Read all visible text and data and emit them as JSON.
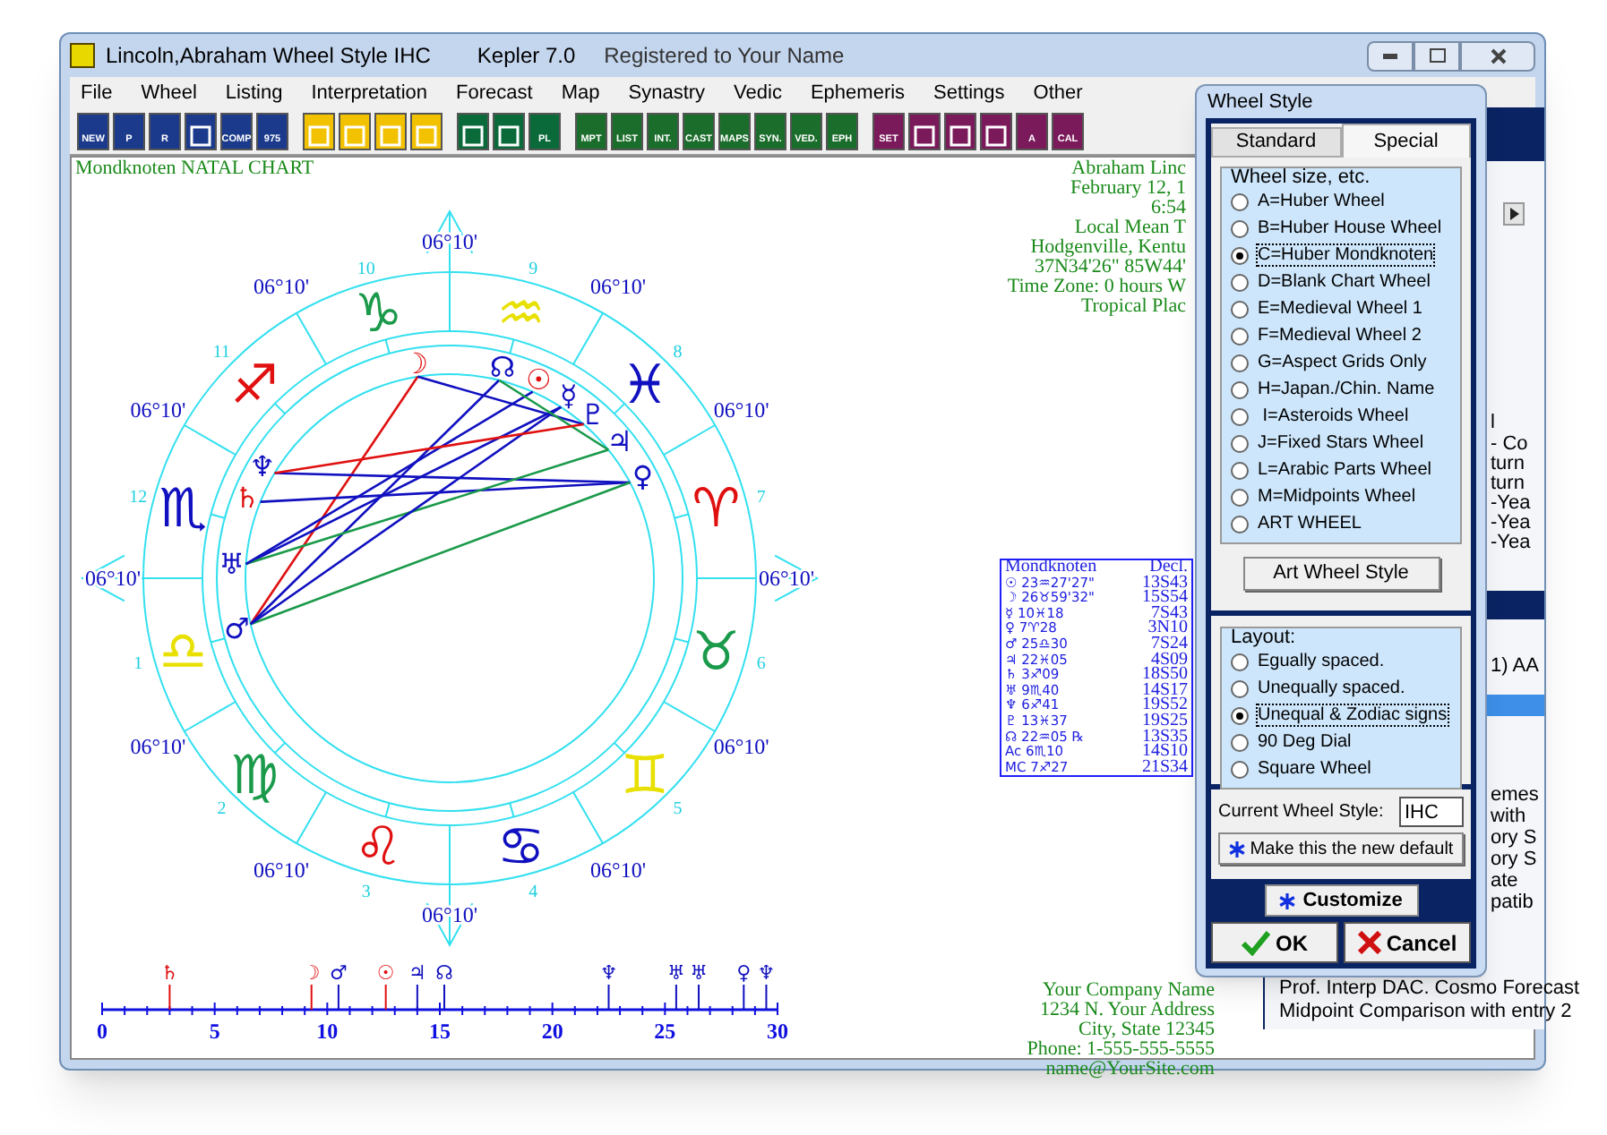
{
  "window": {
    "title": "Lincoln,Abraham Wheel Style IHC",
    "app": "Kepler 7.0",
    "registration": "Registered to Your Name"
  },
  "menu": [
    {
      "label": "File"
    },
    {
      "label": "Wheel"
    },
    {
      "label": "Listing"
    },
    {
      "label": "Interpretation"
    },
    {
      "label": "Forecast"
    },
    {
      "label": "Map"
    },
    {
      "label": "Synastry"
    },
    {
      "label": "Vedic"
    },
    {
      "label": "Ephemeris"
    },
    {
      "label": "Settings"
    },
    {
      "label": "Other"
    }
  ],
  "toolbar_groups": [
    [
      {
        "kind": "text",
        "label": "NEW"
      },
      {
        "kind": "text",
        "label": "P"
      },
      {
        "kind": "text",
        "label": "R"
      },
      {
        "kind": "icon"
      },
      {
        "kind": "text",
        "label": "COMP"
      },
      {
        "kind": "text",
        "label": "975"
      }
    ],
    [
      {
        "kind": "icon"
      },
      {
        "kind": "icon"
      },
      {
        "kind": "icon"
      },
      {
        "kind": "icon"
      }
    ],
    [
      {
        "kind": "icon"
      },
      {
        "kind": "icon"
      },
      {
        "kind": "text",
        "label": "PL"
      }
    ],
    [
      {
        "kind": "text",
        "label": "MPT"
      },
      {
        "kind": "text",
        "label": "LIST"
      },
      {
        "kind": "text",
        "label": "INT."
      },
      {
        "kind": "text",
        "label": "CAST"
      },
      {
        "kind": "text",
        "label": "MAPS"
      },
      {
        "kind": "text",
        "label": "SYN."
      },
      {
        "kind": "text",
        "label": "VED."
      },
      {
        "kind": "text",
        "label": "EPH"
      }
    ],
    [
      {
        "kind": "text",
        "label": "SET"
      },
      {
        "kind": "icon"
      },
      {
        "kind": "icon"
      },
      {
        "kind": "icon"
      },
      {
        "kind": "text",
        "label": "A"
      },
      {
        "kind": "text",
        "label": "CAL"
      }
    ]
  ],
  "chart": {
    "title": "Mondknoten NATAL CHART",
    "cusp_labels": [
      "06°10'",
      "06°10'",
      "06°10'",
      "06°10'",
      "06°10'",
      "06°10'",
      "06°10'",
      "06°10'",
      "06°10'",
      "06°10'",
      "06°10'",
      "06°10'"
    ],
    "houses": [
      "1",
      "2",
      "3",
      "4",
      "5",
      "6",
      "7",
      "8",
      "9",
      "10",
      "11",
      "12"
    ],
    "signs": [
      {
        "glyph": "♑",
        "color": "#1a9a4a"
      },
      {
        "glyph": "♒",
        "color": "#e8e000"
      },
      {
        "glyph": "♓",
        "color": "#1010c0"
      },
      {
        "glyph": "♈",
        "color": "#e01010"
      },
      {
        "glyph": "♉",
        "color": "#1a9a4a"
      },
      {
        "glyph": "♊",
        "color": "#e8e000"
      },
      {
        "glyph": "♋",
        "color": "#1010c0"
      },
      {
        "glyph": "♌",
        "color": "#e01010"
      },
      {
        "glyph": "♍",
        "color": "#1a9a4a"
      },
      {
        "glyph": "♎",
        "color": "#e8e000"
      },
      {
        "glyph": "♏",
        "color": "#1010c0"
      },
      {
        "glyph": "♐",
        "color": "#e01010"
      }
    ],
    "planets": [
      {
        "glyph": "☽",
        "color": "#e01010"
      },
      {
        "glyph": "☊",
        "color": "#1010c0"
      },
      {
        "glyph": "☉",
        "color": "#e01010"
      },
      {
        "glyph": "☿",
        "color": "#1010c0"
      },
      {
        "glyph": "♇",
        "color": "#1010c0"
      },
      {
        "glyph": "♃",
        "color": "#1010c0"
      },
      {
        "glyph": "♀",
        "color": "#1010c0"
      },
      {
        "glyph": "♆",
        "color": "#1010c0"
      },
      {
        "glyph": "♄",
        "color": "#e01010"
      },
      {
        "glyph": "♅",
        "color": "#1010c0"
      },
      {
        "glyph": "♂",
        "color": "#1010c0"
      }
    ]
  },
  "info_lines": [
    "Abraham Linc",
    "February 12, 1",
    "6:54",
    "Local Mean T",
    "Hodgenville, Kentu",
    "37N34'26\"  85W44'",
    "Time Zone: 0 hours W",
    "Tropical Plac"
  ],
  "positions_table": {
    "columns": [
      "Mondknoten",
      "Decl."
    ],
    "rows": [
      [
        "☉ 23♒27'27\"",
        "13S43"
      ],
      [
        "☽ 26♉59'32\"",
        "15S54"
      ],
      [
        "☿ 10♓18",
        "7S43"
      ],
      [
        "♀ 7♈28",
        "3N10"
      ],
      [
        "♂ 25♎30",
        "7S24"
      ],
      [
        "♃ 22♓05",
        "4S09"
      ],
      [
        "♄ 3♐09",
        "18S50"
      ],
      [
        "♅ 9♏40",
        "14S17"
      ],
      [
        "♆ 6♐41",
        "19S52"
      ],
      [
        "♇ 13♓37",
        "19S25"
      ],
      [
        "☊ 22♒05 ℞",
        "13S35"
      ],
      [
        "Ac 6♏10",
        "14S10"
      ],
      [
        "MC 7♐27",
        "21S34"
      ]
    ]
  },
  "dial": {
    "ticks": [
      "0",
      "5",
      "10",
      "15",
      "20",
      "25",
      "30"
    ],
    "markers": [
      {
        "glyph": "♄",
        "color": "#e01010"
      },
      {
        "glyph": "☽",
        "color": "#e01010"
      },
      {
        "glyph": "♂",
        "color": "#1010c0"
      },
      {
        "glyph": "☉",
        "color": "#e01010"
      },
      {
        "glyph": "♃",
        "color": "#1010c0"
      },
      {
        "glyph": "☊",
        "color": "#1010c0"
      },
      {
        "glyph": "♆",
        "color": "#1010c0"
      },
      {
        "glyph": "♅",
        "color": "#1010c0"
      },
      {
        "glyph": "♅",
        "color": "#1010c0"
      },
      {
        "glyph": "♀",
        "color": "#1010c0"
      },
      {
        "glyph": "♆",
        "color": "#1010c0"
      }
    ]
  },
  "company": [
    "Your Company Name",
    "1234 N. Your Address",
    "City, State 12345",
    "Phone: 1-555-555-5555",
    "name@YourSite.com"
  ],
  "background_window": {
    "fragments": [
      "l",
      "- Co",
      "turn",
      "turn",
      "-Yea",
      "-Yea",
      "-Yea",
      "1) AA",
      "emes",
      "with",
      "ory S",
      "ory S",
      "ate",
      "patib"
    ],
    "lines": [
      "Prof. Interp DAC. Cosmo Forecast",
      "Midpoint Comparison  with entry 2"
    ]
  },
  "dialog": {
    "title": "Wheel Style",
    "tabs": [
      {
        "label": "Standard",
        "selected": false
      },
      {
        "label": "Special",
        "selected": true
      }
    ],
    "size_group": {
      "label": "Wheel size, etc.",
      "options": [
        {
          "label": "A=Huber Wheel",
          "selected": false
        },
        {
          "label": "B=Huber House Wheel",
          "selected": false
        },
        {
          "label": "C=Huber Mondknoten",
          "selected": true
        },
        {
          "label": "D=Blank Chart Wheel",
          "selected": false
        },
        {
          "label": "E=Medieval Wheel 1",
          "selected": false
        },
        {
          "label": "F=Medieval Wheel 2",
          "selected": false
        },
        {
          "label": "G=Aspect Grids Only",
          "selected": false
        },
        {
          "label": "H=Japan./Chin. Name",
          "selected": false
        },
        {
          "label": " I=Asteroids Wheel",
          "selected": false
        },
        {
          "label": "J=Fixed Stars Wheel",
          "selected": false
        },
        {
          "label": "L=Arabic Parts Wheel",
          "selected": false
        },
        {
          "label": "M=Midpoints Wheel",
          "selected": false
        },
        {
          "label": "ART WHEEL",
          "selected": false
        }
      ]
    },
    "art_button": "Art Wheel Style",
    "layout_group": {
      "label": "Layout:",
      "options": [
        {
          "label": "Egually spaced.",
          "selected": false
        },
        {
          "label": "Unequally spaced.",
          "selected": false
        },
        {
          "label": "Unequal & Zodiac signs",
          "selected": true
        },
        {
          "label": "90 Deg Dial",
          "selected": false
        },
        {
          "label": "Square Wheel",
          "selected": false
        }
      ]
    },
    "current_label": "Current Wheel Style:",
    "current_value": "IHC",
    "default_button": "Make this the new default",
    "customize_button": "Customize",
    "ok_button": "OK",
    "cancel_button": "Cancel"
  }
}
